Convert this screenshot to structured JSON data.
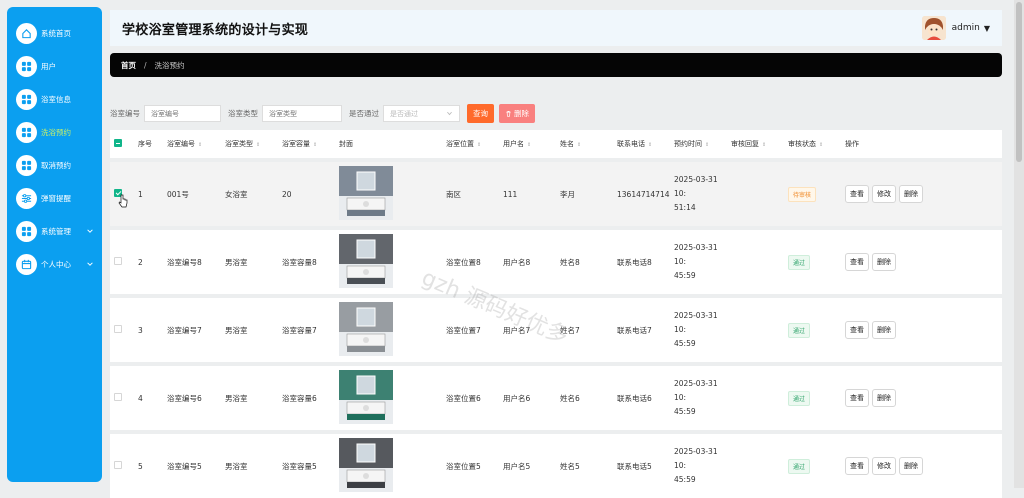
{
  "sidebar": {
    "items": [
      {
        "label": "系统首页",
        "icon": "home-icon",
        "active": false
      },
      {
        "label": "用户",
        "icon": "grid-icon",
        "active": false
      },
      {
        "label": "浴室信息",
        "icon": "grid-icon",
        "active": false
      },
      {
        "label": "洗浴预约",
        "icon": "grid-icon",
        "active": true
      },
      {
        "label": "取消预约",
        "icon": "grid-icon",
        "active": false
      },
      {
        "label": "弹窗提醒",
        "icon": "sliders-icon",
        "active": false
      },
      {
        "label": "系统管理",
        "icon": "grid-icon",
        "active": false,
        "expandable": true
      },
      {
        "label": "个人中心",
        "icon": "calendar-icon",
        "active": false,
        "expandable": true
      }
    ]
  },
  "header": {
    "title": "学校浴室管理系统的设计与实现",
    "username": "admin",
    "caret": "▼"
  },
  "breadcrumb": {
    "home": "首页",
    "separator": "/",
    "current": "洗浴预约"
  },
  "search": {
    "field1_label": "浴室编号",
    "field1_placeholder": "浴室编号",
    "field2_label": "浴室类型",
    "field2_placeholder": "浴室类型",
    "field3_label": "是否通过",
    "field3_placeholder": "是否通过",
    "query_button": "查询",
    "delete_button": "删除"
  },
  "table": {
    "headers": [
      "序号",
      "浴室编号",
      "浴室类型",
      "浴室容量",
      "封面",
      "浴室位置",
      "用户名",
      "姓名",
      "联系电话",
      "预约时间",
      "审核回复",
      "审核状态",
      "操作"
    ],
    "view_label": "查看",
    "edit_label": "修改",
    "delete_label": "删除",
    "rows": [
      {
        "index": "1",
        "bath_no": "001号",
        "bath_type": "女浴室",
        "capacity": "20",
        "location": "南区",
        "username": "111",
        "name": "李月",
        "phone": "13614714714",
        "time_line1": "2025-03-31 10:",
        "time_line2": "51:14",
        "reply": "",
        "status": "待审核",
        "status_kind": "pending",
        "checked": true,
        "has_edit": true,
        "cover_theme": "#6d7a88"
      },
      {
        "index": "2",
        "bath_no": "浴室编号8",
        "bath_type": "男浴室",
        "capacity": "浴室容量8",
        "location": "浴室位置8",
        "username": "用户名8",
        "name": "姓名8",
        "phone": "联系电话8",
        "time_line1": "2025-03-31 10:",
        "time_line2": "45:59",
        "reply": "",
        "status": "通过",
        "status_kind": "passed",
        "checked": false,
        "has_edit": false,
        "cover_theme": "#4a4f55"
      },
      {
        "index": "3",
        "bath_no": "浴室编号7",
        "bath_type": "男浴室",
        "capacity": "浴室容量7",
        "location": "浴室位置7",
        "username": "用户名7",
        "name": "姓名7",
        "phone": "联系电话7",
        "time_line1": "2025-03-31 10:",
        "time_line2": "45:59",
        "reply": "",
        "status": "通过",
        "status_kind": "passed",
        "checked": false,
        "has_edit": false,
        "cover_theme": "#8a8f94"
      },
      {
        "index": "4",
        "bath_no": "浴室编号6",
        "bath_type": "男浴室",
        "capacity": "浴室容量6",
        "location": "浴室位置6",
        "username": "用户名6",
        "name": "姓名6",
        "phone": "联系电话6",
        "time_line1": "2025-03-31 10:",
        "time_line2": "45:59",
        "reply": "",
        "status": "通过",
        "status_kind": "passed",
        "checked": false,
        "has_edit": false,
        "cover_theme": "#1f6f5c"
      },
      {
        "index": "5",
        "bath_no": "浴室编号5",
        "bath_type": "男浴室",
        "capacity": "浴室容量5",
        "location": "浴室位置5",
        "username": "用户名5",
        "name": "姓名5",
        "phone": "联系电话5",
        "time_line1": "2025-03-31 10:",
        "time_line2": "45:59",
        "reply": "",
        "status": "通过",
        "status_kind": "passed",
        "checked": false,
        "has_edit": true,
        "cover_theme": "#3c3f44"
      }
    ]
  },
  "watermark": "gzh 源码好优多",
  "colors": {
    "sidebar": "#0b9ff0",
    "active_text": "#c7f06a",
    "query_button": "#ff6a2b",
    "delete_button": "#f9807f",
    "checkbox": "#10b58a"
  }
}
